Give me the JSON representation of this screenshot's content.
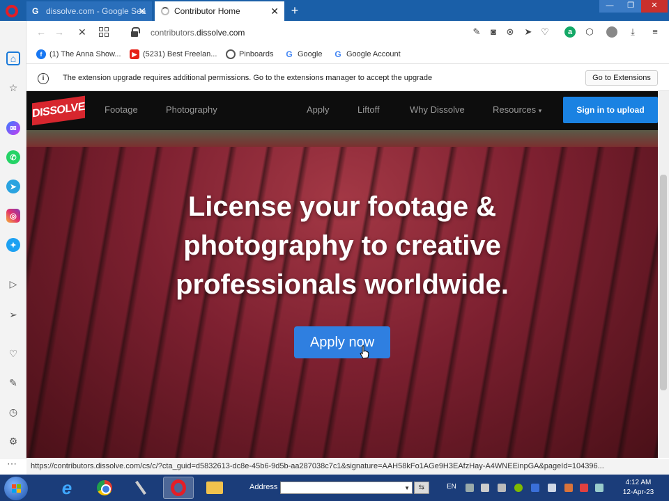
{
  "browser": {
    "tabs": [
      {
        "label": "dissolve.com - Google Sea",
        "favicon": "google-icon",
        "active": false
      },
      {
        "label": "Contributor Home",
        "favicon": "loading-spinner-icon",
        "active": true
      }
    ],
    "new_tab_glyph": "+",
    "address": {
      "prefix": "contributors.",
      "domain": "dissolve.com"
    },
    "status_url": "https://contributors.dissolve.com/cs/c/?cta_guid=d5832613-dc8e-45b6-9d5b-aa287038c7c1&signature=AAH58kFo1AGe9H3EAfzHay-A4WNEEinpGA&pageId=104396..."
  },
  "bookmarks": [
    {
      "label": "(1) The Anna Show...",
      "icon": "facebook-icon",
      "color": "#1877f2"
    },
    {
      "label": "(5231) Best Freelan...",
      "icon": "youtube-icon",
      "color": "#e62117"
    },
    {
      "label": "Pinboards",
      "icon": "pinboards-icon",
      "color": "#555555"
    },
    {
      "label": "Google",
      "icon": "google-icon",
      "color": "#4285f4"
    },
    {
      "label": "Google Account",
      "icon": "google-icon",
      "color": "#4285f4"
    }
  ],
  "notification": {
    "text": "The extension upgrade requires additional permissions. Go to the extensions manager to accept the upgrade",
    "button": "Go to Extensions"
  },
  "site": {
    "logo": "DISSOLVE",
    "brand_color": "#d7262e",
    "nav_left": [
      "Footage",
      "Photography"
    ],
    "nav_right": [
      "Apply",
      "Liftoff",
      "Why Dissolve",
      "Resources"
    ],
    "signin": "Sign in to upload",
    "accent": "#1a82e2",
    "hero_lines": [
      "License your footage &",
      "photography to creative",
      "professionals worldwide."
    ],
    "cta": "Apply now"
  },
  "taskbar": {
    "address_label": "Address",
    "lang": "EN",
    "time": "4:12 AM",
    "date": "12-Apr-23"
  }
}
